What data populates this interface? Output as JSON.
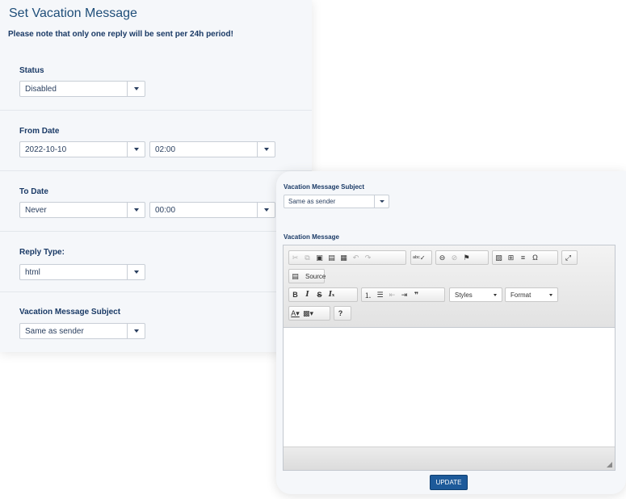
{
  "page": {
    "title": "Set Vacation Message",
    "notice": "Please note that only one reply will be sent per 24h period!"
  },
  "form": {
    "status": {
      "label": "Status",
      "value": "Disabled"
    },
    "from_date": {
      "label": "From Date",
      "date": "2022-10-10",
      "time": "02:00"
    },
    "to_date": {
      "label": "To Date",
      "date": "Never",
      "time": "00:00"
    },
    "reply_type": {
      "label": "Reply Type:",
      "value": "html"
    },
    "subject": {
      "label": "Vacation Message Subject",
      "value": "Same as sender"
    }
  },
  "editor_panel": {
    "subject_label": "Vacation Message Subject",
    "subject_value": "Same as sender",
    "message_label": "Vacation Message",
    "toolbar": {
      "source_label": "Source",
      "styles_label": "Styles",
      "format_label": "Format"
    },
    "update_label": "UPDATE"
  },
  "colors": {
    "accent": "#1d5a9a",
    "label": "#1a3a66",
    "title": "#1f4e79"
  }
}
